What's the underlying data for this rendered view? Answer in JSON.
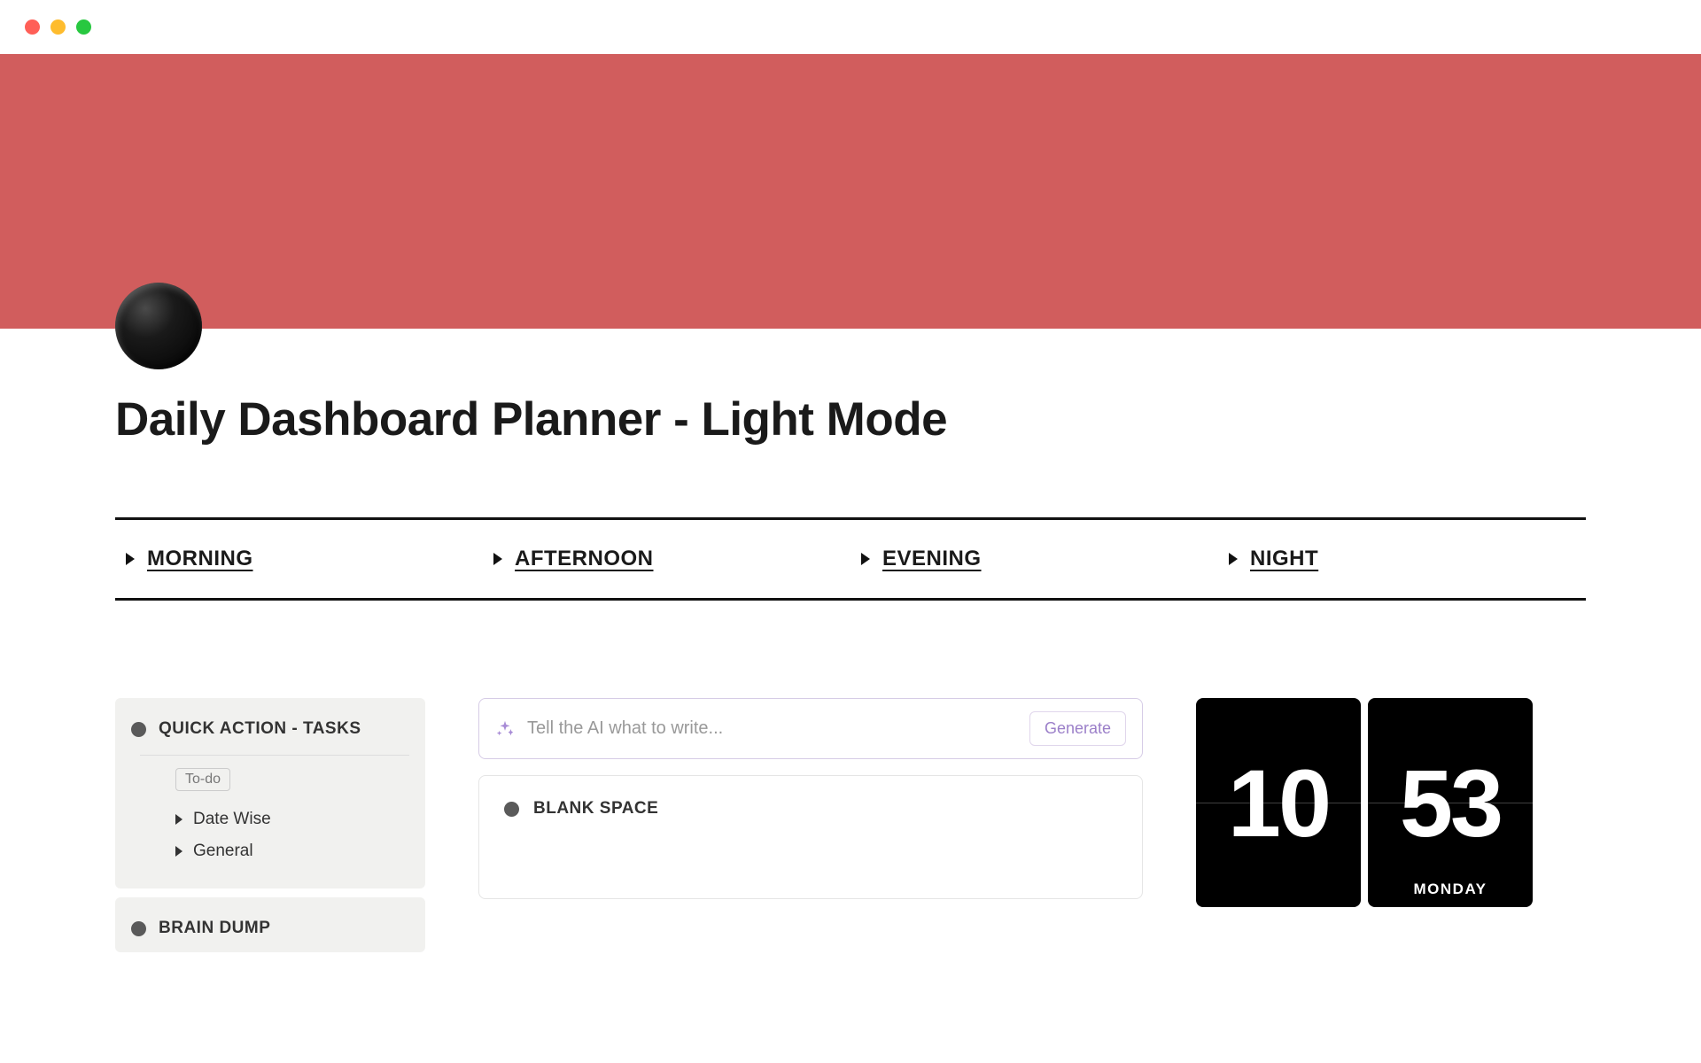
{
  "colors": {
    "banner": "#d15d5d",
    "accent_purple": "#9b7fc9"
  },
  "page": {
    "title": "Daily Dashboard Planner - Light Mode"
  },
  "time_sections": [
    "MORNING",
    "AFTERNOON",
    "EVENING",
    "NIGHT"
  ],
  "sidebar": {
    "cards": [
      {
        "title": "QUICK ACTION - TASKS",
        "tag": "To-do",
        "items": [
          "Date Wise",
          "General"
        ]
      },
      {
        "title": "BRAIN DUMP",
        "tag": null,
        "items": []
      }
    ]
  },
  "ai": {
    "placeholder": "Tell the AI what to write...",
    "generate_label": "Generate"
  },
  "blank_space": {
    "title": "BLANK SPACE"
  },
  "clock": {
    "hours": "10",
    "minutes": "53",
    "day": "MONDAY"
  }
}
